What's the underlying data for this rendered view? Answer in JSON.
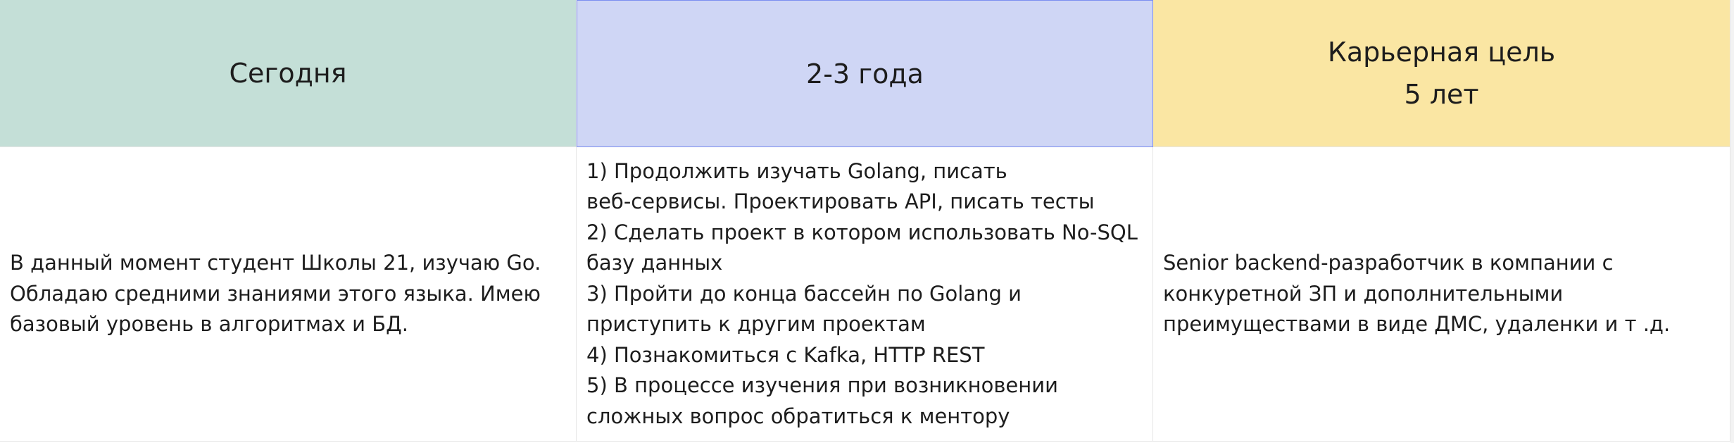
{
  "table": {
    "headers": [
      "Сегодня",
      "2-3 года",
      "Карьерная цель\n5 лет"
    ],
    "cells": [
      "В данный момент студент Школы 21, изучаю Go.\nОбладаю средними знаниями этого языка. Имею\nбазовый уровень в алгоритмах и БД.",
      "1) Продолжить изучать Golang, писать\nвеб-сервисы. Проектировать API, писать тесты\n2) Сделать проект в котором использовать No-SQL\nбазу данных\n3) Пройти до конца бассейн по Golang и\nприступить к другим проектам\n4) Познакомиться с Kafka, HTTP REST\n5) В процессе изучения при возникновении\nсложных вопрос обратиться к ментору",
      "Senior backend-разработчик в компании с\nконкуретной ЗП и дополнительными\nпреимуществами в виде ДМС, удаленки и т .д."
    ]
  },
  "colors": {
    "today": "#c4dfd7",
    "two_three_years": "#cfd6f5",
    "goal": "#fae6a3"
  }
}
